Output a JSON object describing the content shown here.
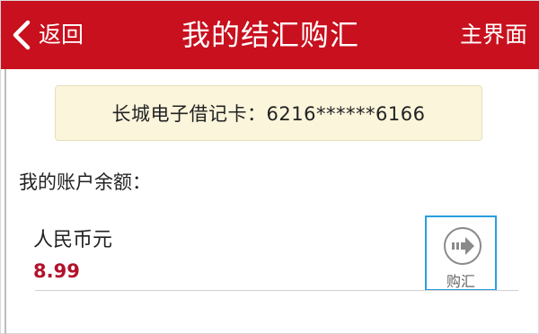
{
  "header": {
    "back_label": "返回",
    "title": "我的结汇购汇",
    "home_label": "主界面",
    "bg_color": "#c8101e"
  },
  "card": {
    "text": "长城电子借记卡：6216******6166"
  },
  "balance": {
    "label": "我的账户余额："
  },
  "account": {
    "currency": "人民币元",
    "amount": "8.99",
    "action_label": "购汇",
    "action_icon": "arrow-right-circle-icon"
  }
}
